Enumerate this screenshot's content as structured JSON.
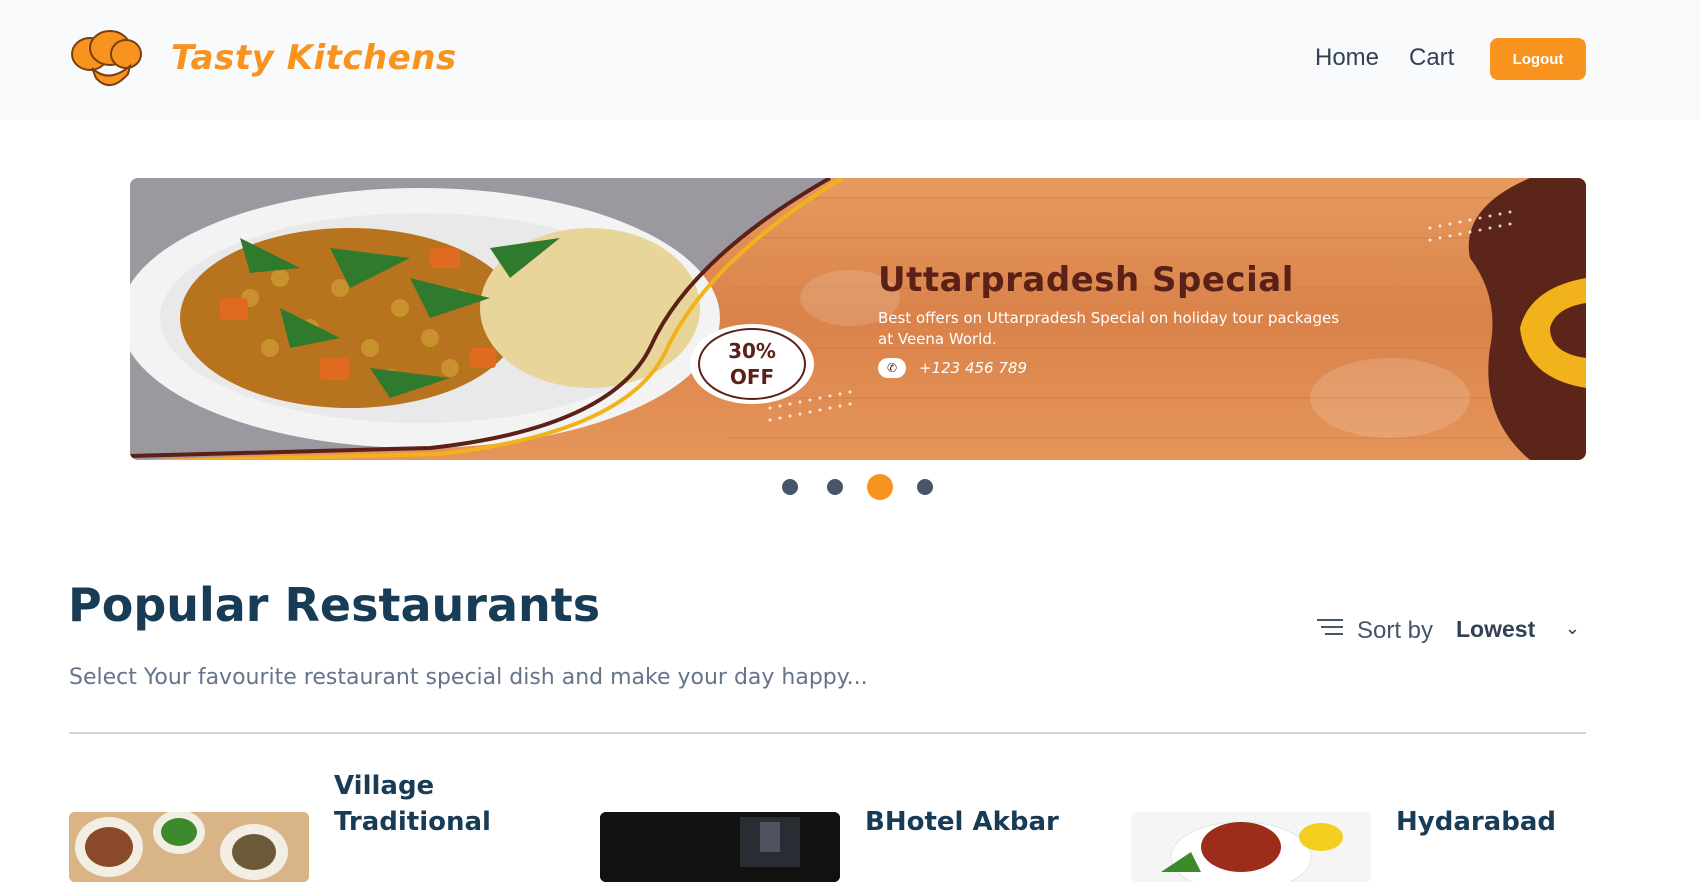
{
  "header": {
    "brand": "Tasty Kitchens",
    "logo_icon": "chef-hat-icon",
    "nav": {
      "home": "Home",
      "cart": "Cart"
    },
    "logout_label": "Logout",
    "accent_color": "#f7931e"
  },
  "banner": {
    "title": "Uttarpradesh Special",
    "description": "Best offers on Uttarpradesh Special on holiday tour packages at Veena World.",
    "phone": "+123 456 789",
    "phone_icon": "whatsapp-icon",
    "badge_line1": "30%",
    "badge_line2": "OFF"
  },
  "carousel": {
    "total": 4,
    "active_index": 3
  },
  "section": {
    "title": "Popular Restaurants",
    "subtitle": "Select Your favourite restaurant special dish and make your day happy...",
    "sort_label": "Sort by",
    "sort_value": "Lowest",
    "sort_icon": "sort-lines-icon"
  },
  "restaurants": [
    {
      "name": "Village Traditional"
    },
    {
      "name": "BHotel Akbar"
    },
    {
      "name": "Hydarabad"
    }
  ]
}
